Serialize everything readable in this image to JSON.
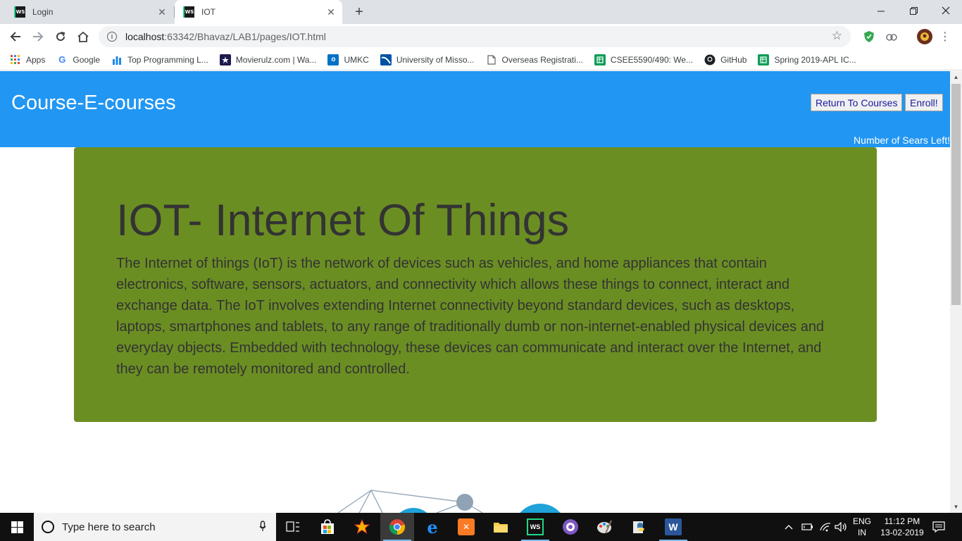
{
  "browser": {
    "tabs": [
      {
        "title": "Login",
        "favicon": "WS"
      },
      {
        "title": "IOT",
        "favicon": "WS"
      }
    ],
    "url_host": "localhost",
    "url_path": ":63342/Bhavaz/LAB1/pages/IOT.html",
    "bookmarks": [
      {
        "label": "Apps",
        "icon": "apps-grid-icon"
      },
      {
        "label": "Google",
        "icon": "google-icon"
      },
      {
        "label": "Top Programming L...",
        "icon": "chart-icon"
      },
      {
        "label": "Movierulz.com | Wa...",
        "icon": "movie-icon"
      },
      {
        "label": "UMKC",
        "icon": "outlook-icon"
      },
      {
        "label": "University of Misso...",
        "icon": "university-icon"
      },
      {
        "label": "Overseas Registrati...",
        "icon": "document-icon"
      },
      {
        "label": "CSEE5590/490: We...",
        "icon": "sheets-icon"
      },
      {
        "label": "GitHub",
        "icon": "github-icon"
      },
      {
        "label": "Spring 2019-APL IC...",
        "icon": "sheets-icon"
      }
    ]
  },
  "page": {
    "site_title": "Course-E-courses",
    "return_button": "Return To Courses",
    "enroll_button": "Enroll!",
    "seats_text": "Number of Sears Left!",
    "heading": "IOT- Internet Of Things",
    "body": "The Internet of things (IoT) is the network of devices such as vehicles, and home appliances that contain electronics, software, sensors, actuators, and connectivity which allows these things to connect, interact and exchange data. The IoT involves extending Internet connectivity beyond standard devices, such as desktops, laptops, smartphones and tablets, to any range of traditionally dumb or non-internet-enabled physical devices and everyday objects. Embedded with technology, these devices can communicate and interact over the Internet, and they can be remotely monitored and controlled."
  },
  "colors": {
    "header_bg": "#2196f3",
    "jumbotron_bg": "#6b8e23",
    "text_dark": "#333333"
  },
  "taskbar": {
    "search_placeholder": "Type here to search",
    "language_line1": "ENG",
    "language_line2": "IN",
    "time": "11:12 PM",
    "date": "13-02-2019"
  }
}
